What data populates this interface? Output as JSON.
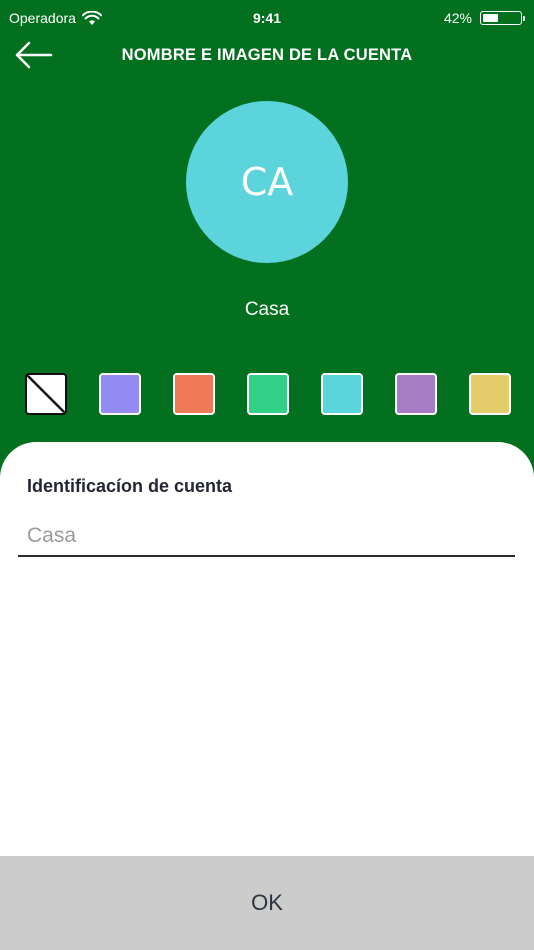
{
  "status_bar": {
    "carrier": "Operadora",
    "time": "9:41",
    "battery_percent": "42%",
    "battery_level": 0.42
  },
  "header": {
    "title": "NOMBRE E IMAGEN DE LA CUENTA",
    "back_icon": "arrow-left-icon"
  },
  "avatar": {
    "initials": "CA",
    "color": "#5cd4db"
  },
  "account": {
    "name": "Casa"
  },
  "colors": {
    "header_bg": "#03701f",
    "swatches": [
      "none",
      "#948bf2",
      "#ef7857",
      "#31d087",
      "#5cd4db",
      "#a67cc5",
      "#e4cc6a"
    ]
  },
  "form": {
    "label": "Identificacíon de cuenta",
    "placeholder": "Casa",
    "value": ""
  },
  "ok_button": {
    "label": "OK"
  }
}
